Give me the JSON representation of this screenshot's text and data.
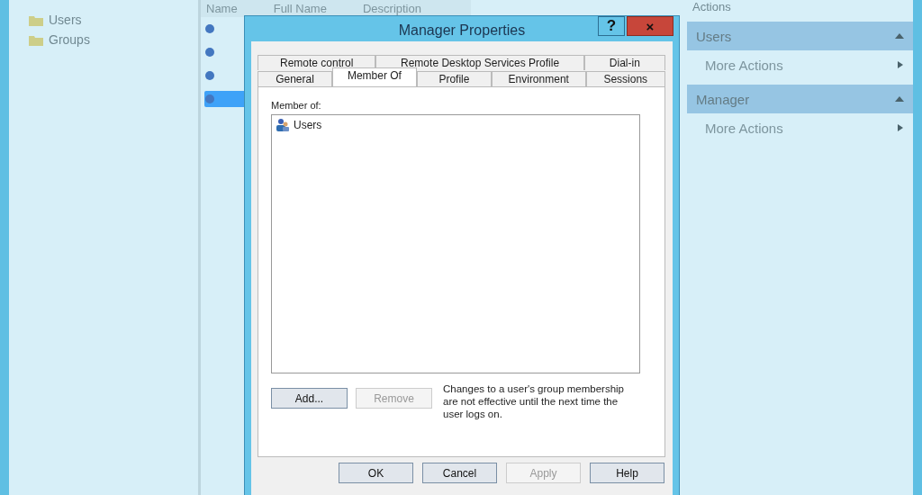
{
  "tree": {
    "items": [
      {
        "label": "Users",
        "selected": false
      },
      {
        "label": "Groups",
        "selected": false
      }
    ]
  },
  "list": {
    "columns": [
      "Name",
      "Full Name",
      "Description"
    ],
    "rows": [
      {
        "selected": false
      },
      {
        "selected": false
      },
      {
        "selected": false
      },
      {
        "selected": true
      }
    ]
  },
  "actions": {
    "title": "Actions",
    "sections": [
      {
        "title": "Users",
        "items": [
          "More Actions"
        ]
      },
      {
        "title": "Manager",
        "items": [
          "More Actions"
        ]
      }
    ]
  },
  "dialog": {
    "title": "Manager Properties",
    "help": "?",
    "close": "×",
    "tab_rows": [
      [
        {
          "label": "Remote control",
          "selected": false
        },
        {
          "label": "Remote Desktop Services Profile",
          "selected": false
        },
        {
          "label": "Dial-in",
          "selected": false
        }
      ],
      [
        {
          "label": "General",
          "selected": false
        },
        {
          "label": "Member Of",
          "selected": true
        },
        {
          "label": "Profile",
          "selected": false
        },
        {
          "label": "Environment",
          "selected": false
        },
        {
          "label": "Sessions",
          "selected": false
        }
      ]
    ],
    "member_label": "Member of:",
    "members": [
      {
        "label": "Users",
        "selected": false
      }
    ],
    "member_buttons": [
      {
        "label": "Add...",
        "disabled": false
      },
      {
        "label": "Remove",
        "disabled": true
      }
    ],
    "note": "Changes to a user's group membership are not effective until the next time the user logs on.",
    "buttons": [
      {
        "label": "OK",
        "disabled": false
      },
      {
        "label": "Cancel",
        "disabled": false
      },
      {
        "label": "Apply",
        "disabled": true
      },
      {
        "label": "Help",
        "disabled": false
      }
    ]
  }
}
